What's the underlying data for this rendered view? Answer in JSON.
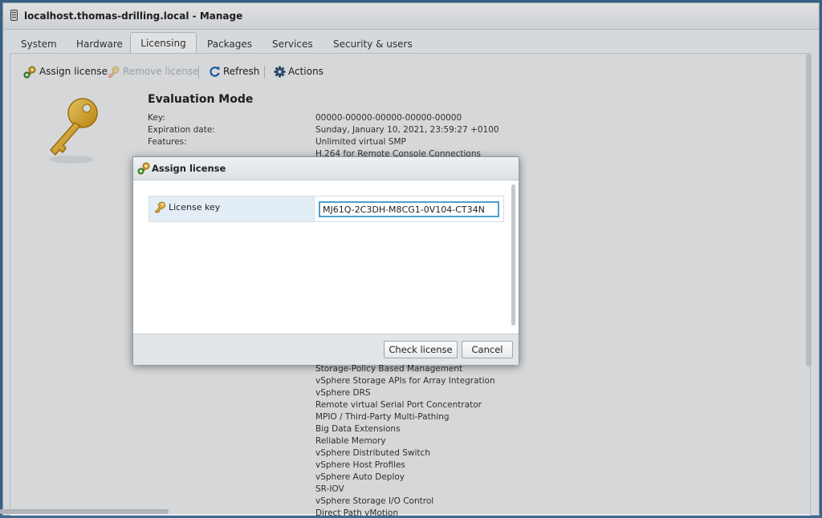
{
  "window": {
    "title": "localhost.thomas-drilling.local - Manage"
  },
  "tabs": [
    {
      "label": "System"
    },
    {
      "label": "Hardware"
    },
    {
      "label": "Licensing",
      "active": true
    },
    {
      "label": "Packages"
    },
    {
      "label": "Services"
    },
    {
      "label": "Security & users"
    }
  ],
  "toolbar": {
    "assign": "Assign license",
    "remove": "Remove license",
    "refresh": "Refresh",
    "actions": "Actions"
  },
  "license": {
    "mode_title": "Evaluation Mode",
    "key_label": "Key:",
    "key_value": "00000-00000-00000-00000-00000",
    "expiration_label": "Expiration date:",
    "expiration_value": "Sunday, January 10, 2021, 23:59:27 +0100",
    "features_label": "Features:",
    "features_top": [
      "Unlimited virtual SMP",
      "H.264 for Remote Console Connections"
    ],
    "features_bottom": [
      "Storage-Policy Based Management",
      "vSphere Storage APIs for Array Integration",
      "vSphere DRS",
      "Remote virtual Serial Port Concentrator",
      "MPIO / Third-Party Multi-Pathing",
      "Big Data Extensions",
      "Reliable Memory",
      "vSphere Distributed Switch",
      "vSphere Host Profiles",
      "vSphere Auto Deploy",
      "SR-IOV",
      "vSphere Storage I/O Control",
      "Direct Path vMotion"
    ]
  },
  "dialog": {
    "title": "Assign license",
    "field_label": "License key",
    "field_value": "MJ61Q-2C3DH-M8CG1-0V104-CT34N",
    "check_button": "Check license",
    "cancel_button": "Cancel"
  },
  "icons": {
    "assign": "key-add-icon",
    "remove": "key-remove-icon",
    "refresh": "refresh-icon",
    "actions": "gear-icon",
    "big": "key-icon",
    "field": "key-icon"
  }
}
